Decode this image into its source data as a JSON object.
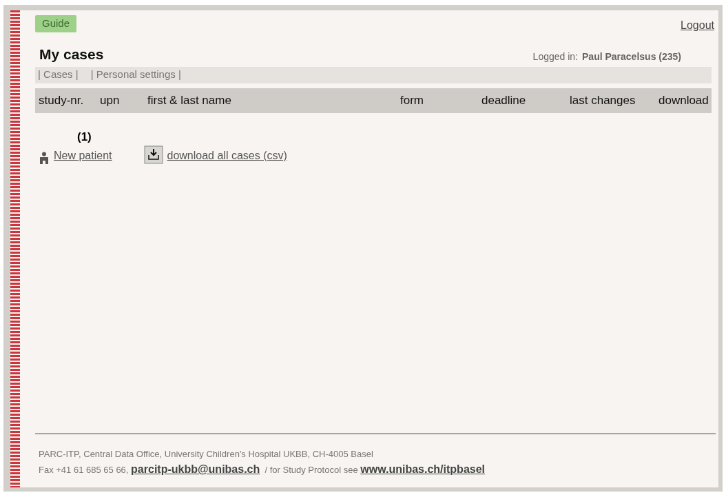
{
  "guide_button": "Guide",
  "logout_link": "Logout",
  "page_title": "My cases",
  "logged_in": {
    "label": "Logged in:",
    "user": "Paul Paracelsus (235)"
  },
  "tabs": [
    {
      "label": "| Cases |"
    },
    {
      "label": "| Personal settings |"
    }
  ],
  "table": {
    "columns": [
      "study-nr.",
      "upn",
      "first & last name",
      "form",
      "deadline",
      "last changes",
      "download"
    ]
  },
  "case_count": "(1)",
  "actions": [
    {
      "kind": "patient",
      "label": "New patient"
    },
    {
      "kind": "download",
      "label": "download all cases (csv)"
    }
  ],
  "footer": {
    "line_1": "PARC-ITP, Central Data Office, University Children's Hospital UKBB, CH-4005 Basel",
    "fax": "Fax +41 61 685 65 66,",
    "email": "parcitp-ukbb@unibas.ch",
    "protocol_text": "/ for Study Protocol see",
    "website": "www.unibas.ch/itpbasel"
  }
}
